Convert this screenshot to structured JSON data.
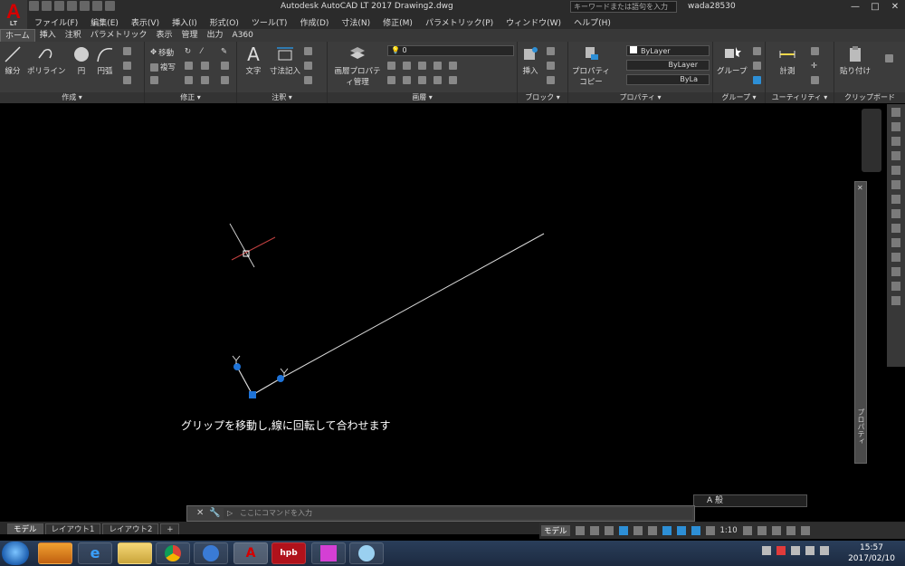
{
  "window": {
    "title": "Autodesk AutoCAD LT 2017     Drawing2.dwg",
    "search_placeholder": "キーワードまたは語句を入力",
    "user": "wada28530",
    "logo_letter": "A",
    "logo_sub": "LT"
  },
  "menu": [
    "ファイル(F)",
    "編集(E)",
    "表示(V)",
    "挿入(I)",
    "形式(O)",
    "ツール(T)",
    "作成(D)",
    "寸法(N)",
    "修正(M)",
    "パラメトリック(P)",
    "ウィンドウ(W)",
    "ヘルプ(H)"
  ],
  "ribbon_tabs": [
    "ホーム",
    "挿入",
    "注釈",
    "パラメトリック",
    "表示",
    "管理",
    "出力",
    "A360"
  ],
  "ribbon": {
    "create": {
      "title": "作成 ▾",
      "line": "線分",
      "polyline": "ポリライン",
      "circle": "円",
      "arc": "円弧"
    },
    "modify": {
      "title": "修正 ▾",
      "move": "移動",
      "copy": "複写"
    },
    "annotation": {
      "title": "注釈 ▾",
      "text": "文字",
      "dimension": "寸法記入"
    },
    "layers": {
      "title": "画層 ▾",
      "layer_props": "画層プロパティ管理",
      "layer_combo": "0"
    },
    "block": {
      "title": "ブロック ▾",
      "insert": "挿入"
    },
    "properties": {
      "title": "プロパティ ▾",
      "match": "プロパティコピー",
      "color": "ByLayer",
      "linetype": "ByLayer",
      "lineweight": "ByLa"
    },
    "groups": {
      "title": "グループ ▾",
      "group": "グループ"
    },
    "utilities": {
      "title": "ユーティリティ ▾",
      "measure": "計測"
    },
    "clipboard": {
      "title": "クリップボード",
      "paste": "貼り付け"
    }
  },
  "canvas": {
    "annotation": "グリップを移動し,線に回転して合わせます",
    "properties_label": "プロパティ"
  },
  "command": {
    "placeholder": "ここにコマンドを入力"
  },
  "ime": {
    "label": "A 般"
  },
  "layouts": [
    "モデル",
    "レイアウト1",
    "レイアウト2",
    "+"
  ],
  "status": {
    "model": "モデル",
    "scale": "1:10"
  },
  "taskbar": {
    "apps": [
      "hpb"
    ],
    "time": "15:57",
    "date": "2017/02/10"
  },
  "colors": {
    "accent": "#2d8fd6",
    "grip": "#1e73d8",
    "line": "#d9d9d9"
  }
}
